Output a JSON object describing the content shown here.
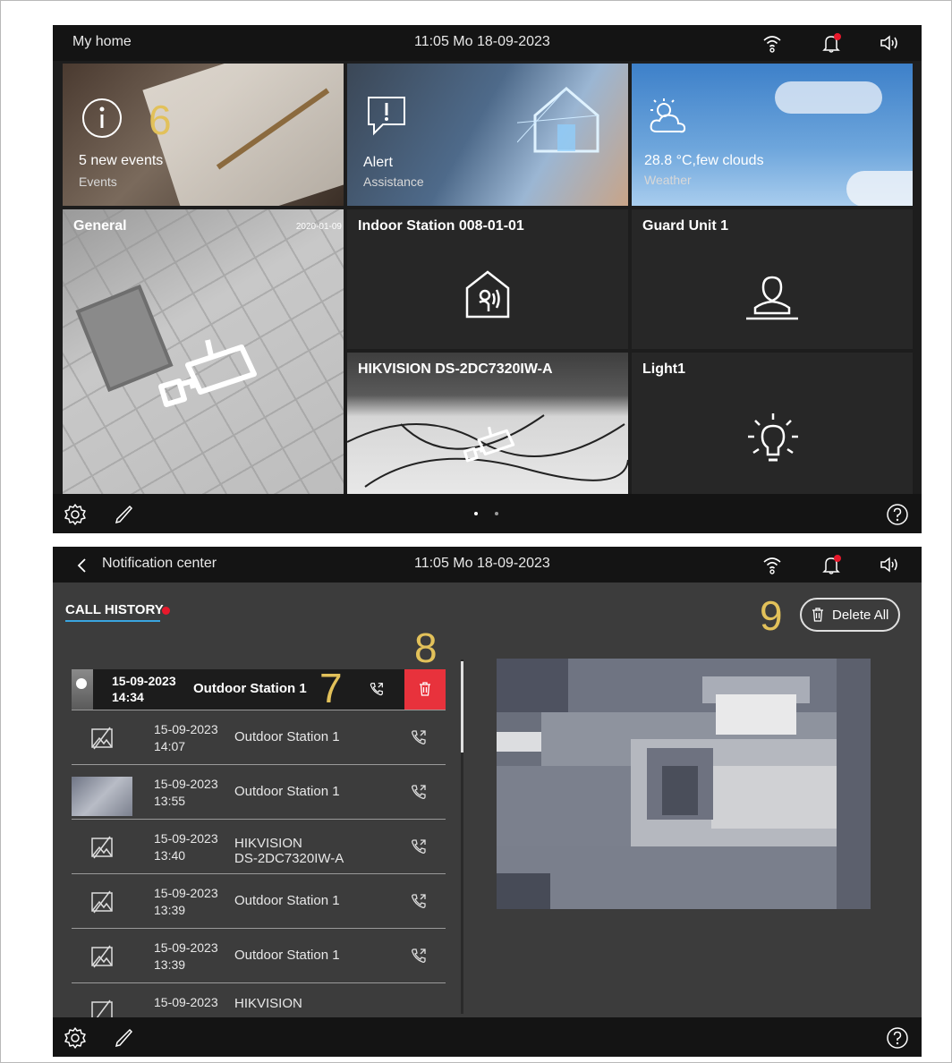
{
  "home": {
    "title": "My home",
    "clock": "11:05  Mo 18-09-2023",
    "tiles": {
      "events": {
        "main": "5 new events",
        "sub": "Events",
        "count": "6"
      },
      "alert": {
        "main": "Alert",
        "sub": "Assistance"
      },
      "weather": {
        "main": "28.8 °C,few clouds",
        "sub": "Weather"
      },
      "general": {
        "name": "General",
        "stamp": "2020-01-09"
      },
      "indoor": {
        "name": "Indoor Station 008-01-01"
      },
      "guard": {
        "name": "Guard Unit 1"
      },
      "hikvision": {
        "name": "HIKVISION DS-2DC7320IW-A"
      },
      "light": {
        "name": "Light1"
      }
    }
  },
  "notification": {
    "title": "Notification center",
    "clock": "11:05  Mo 18-09-2023",
    "tab": "CALL HISTORY",
    "delete_all": "Delete All",
    "selected": {
      "date": "15-09-2023",
      "time": "14:34",
      "source": "Outdoor Station 1"
    },
    "rows": [
      {
        "date": "15-09-2023",
        "time": "14:07",
        "source": "Outdoor Station 1",
        "line2": ""
      },
      {
        "date": "15-09-2023",
        "time": "13:55",
        "source": "Outdoor Station 1",
        "line2": ""
      },
      {
        "date": "15-09-2023",
        "time": "13:40",
        "source": "HIKVISION",
        "line2": "DS-2DC7320IW-A"
      },
      {
        "date": "15-09-2023",
        "time": "13:39",
        "source": "Outdoor Station 1",
        "line2": ""
      },
      {
        "date": "15-09-2023",
        "time": "13:39",
        "source": "Outdoor Station 1",
        "line2": ""
      },
      {
        "date": "15-09-2023",
        "time": "",
        "source": "HIKVISION",
        "line2": ""
      }
    ]
  },
  "annotations": {
    "a7": "7",
    "a8": "8",
    "a9": "9"
  },
  "colors": {
    "accent": "#e2c15a",
    "alert_red": "#e8192c",
    "tab_underline": "#3aa5e0",
    "delete_red": "#e8323c"
  },
  "icons": [
    "wifi-icon",
    "bell-icon",
    "speaker-icon",
    "gear-icon",
    "pencil-icon",
    "help-icon",
    "camera-icon",
    "trash-icon",
    "phone-icon",
    "back-chevron-icon",
    "lightbulb-icon",
    "person-icon",
    "house-voice-icon",
    "info-icon"
  ]
}
